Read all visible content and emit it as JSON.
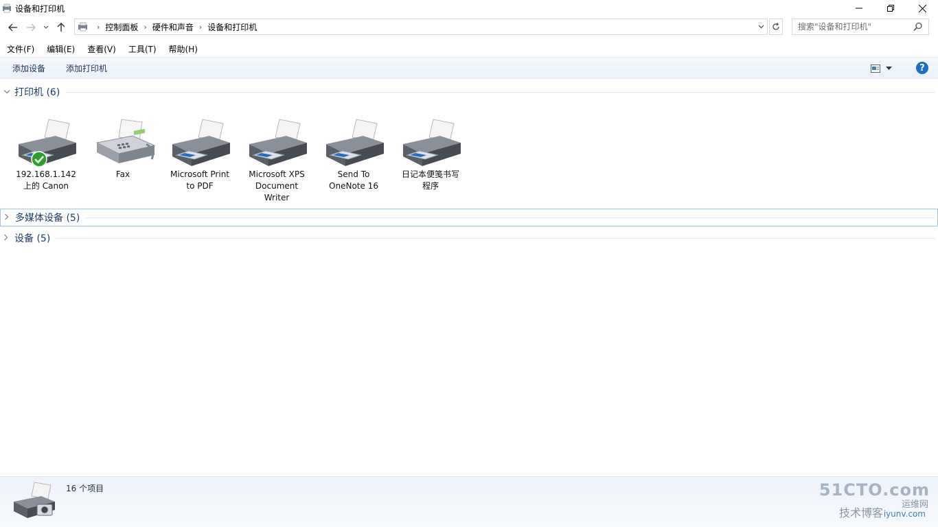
{
  "window": {
    "title": "设备和打印机"
  },
  "nav": {
    "breadcrumbs": [
      "控制面板",
      "硬件和声音",
      "设备和打印机"
    ],
    "search_placeholder": "搜索\"设备和打印机\""
  },
  "menu": [
    "文件(F)",
    "编辑(E)",
    "查看(V)",
    "工具(T)",
    "帮助(H)"
  ],
  "commands": {
    "add_device": "添加设备",
    "add_printer": "添加打印机",
    "help": "?"
  },
  "groups": {
    "printers": {
      "label": "打印机 (6)"
    },
    "multimedia": {
      "label": "多媒体设备 (5)"
    },
    "devices": {
      "label": "设备 (5)"
    }
  },
  "printers": [
    {
      "label_line1": "192.168.1.142",
      "label_line2": "上的 Canon",
      "label_line3": "",
      "icon": "printer-icon",
      "default": true
    },
    {
      "label_line1": "Fax",
      "label_line2": "",
      "label_line3": "",
      "icon": "fax-icon",
      "default": false
    },
    {
      "label_line1": "Microsoft Print",
      "label_line2": "to PDF",
      "label_line3": "",
      "icon": "printer-icon",
      "default": false
    },
    {
      "label_line1": "Microsoft XPS",
      "label_line2": "Document",
      "label_line3": "Writer",
      "icon": "printer-icon",
      "default": false
    },
    {
      "label_line1": "Send To",
      "label_line2": "OneNote 16",
      "label_line3": "",
      "icon": "printer-icon",
      "default": false
    },
    {
      "label_line1": "日记本便笺书写",
      "label_line2": "程序",
      "label_line3": "",
      "icon": "printer-icon",
      "default": false
    }
  ],
  "status": {
    "count": "16 个项目"
  },
  "watermark": {
    "site": "51CTO.com",
    "line2": "技术博客",
    "line3": "运维网",
    "line4": "iyunv.com"
  },
  "colors": {
    "accent": "#1a6fc0",
    "group_title": "#1e3c6f",
    "default_check": "#2aa02a"
  }
}
